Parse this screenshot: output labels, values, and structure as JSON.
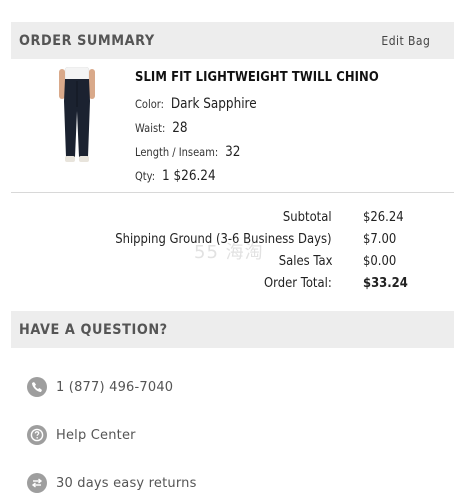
{
  "order_summary": {
    "title": "ORDER SUMMARY",
    "edit_label": "Edit Bag"
  },
  "product": {
    "name": "SLIM FIT LIGHTWEIGHT TWILL CHINO",
    "color_label": "Color:",
    "color_value": "Dark Sapphire",
    "waist_label": "Waist:",
    "waist_value": "28",
    "inseam_label": "Length / Inseam:",
    "inseam_value": "32",
    "qty_label": "Qty:",
    "qty_value": "1 $26.24",
    "colors": {
      "pants": "#1b2230",
      "shirt": "#f4f4f4",
      "skin": "#d9a98a",
      "shoes": "#e8e4dc"
    }
  },
  "totals": {
    "subtotal_label": "Subtotal",
    "subtotal_value": "$26.24",
    "shipping_label": "Shipping Ground (3-6 Business Days)",
    "shipping_value": "$7.00",
    "tax_label": "Sales Tax",
    "tax_value": "$0.00",
    "total_label": "Order Total:",
    "total_value": "$33.24"
  },
  "watermark": "55 海淘",
  "help": {
    "title": "HAVE A QUESTION?",
    "items": [
      {
        "icon": "phone-icon",
        "label": "1 (877) 496-7040"
      },
      {
        "icon": "question-icon",
        "label": "Help Center"
      },
      {
        "icon": "returns-icon",
        "label": "30 days easy returns"
      }
    ]
  }
}
